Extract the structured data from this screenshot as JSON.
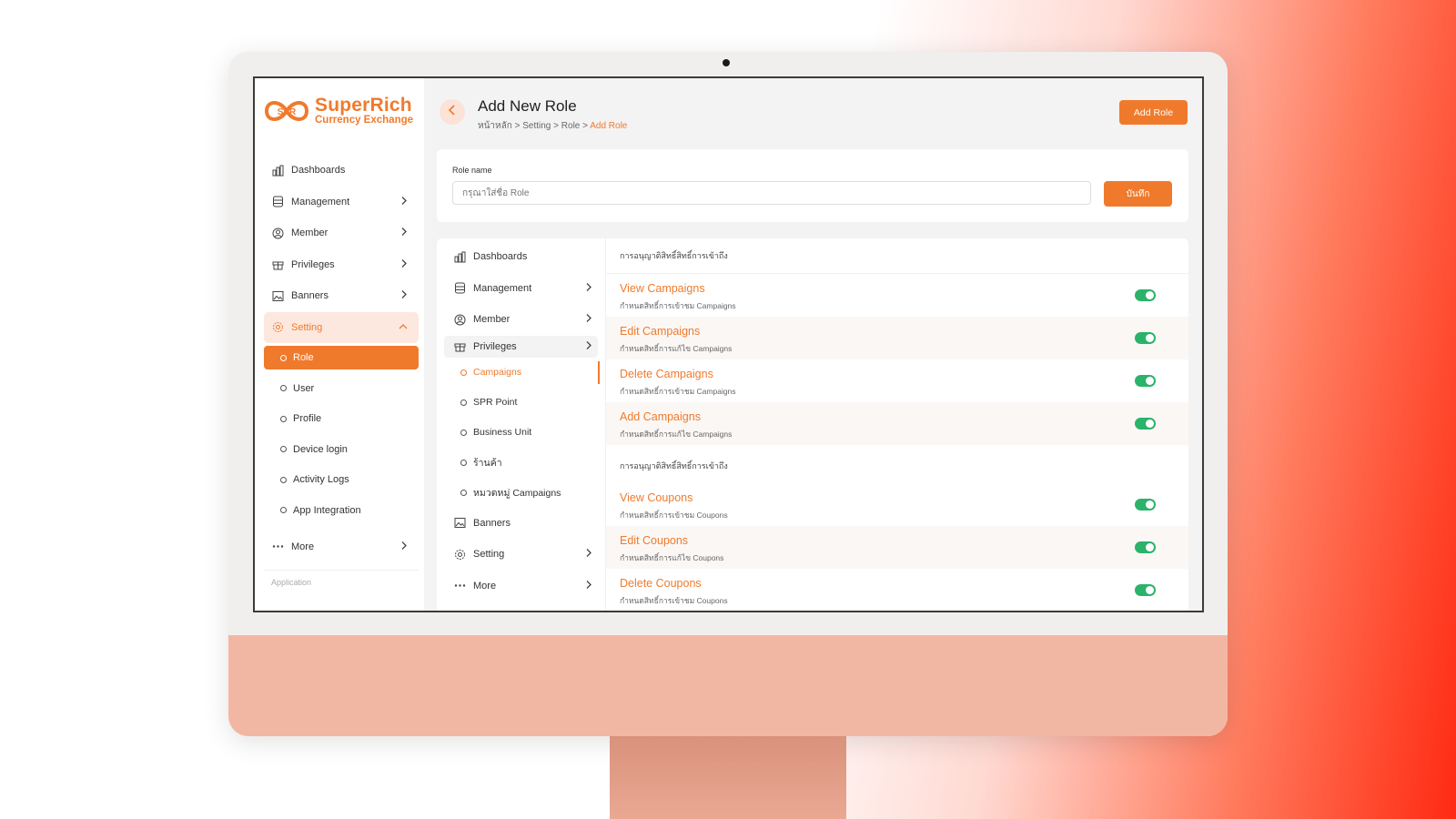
{
  "brand": {
    "mark": "SPR",
    "title": "SuperRich",
    "subtitle": "Currency Exchange",
    "color": "#f07a2c"
  },
  "sidebar": {
    "items": [
      {
        "label": "Dashboards",
        "icon": "bar-chart-icon"
      },
      {
        "label": "Management",
        "icon": "database-icon"
      },
      {
        "label": "Member",
        "icon": "user-circle-icon"
      },
      {
        "label": "Privileges",
        "icon": "gift-icon"
      },
      {
        "label": "Banners",
        "icon": "image-icon"
      },
      {
        "label": "Setting",
        "icon": "gear-icon"
      }
    ],
    "setting_sub": [
      "Role",
      "User",
      "Profile",
      "Device login",
      "Activity Logs",
      "App Integration"
    ],
    "more": "More",
    "app_label": "Application"
  },
  "header": {
    "title": "Add New Role",
    "breadcrumb": [
      "หน้าหลัก",
      "Setting",
      "Role"
    ],
    "breadcrumb_current": "Add Role",
    "add_role_label": "Add Role"
  },
  "role_form": {
    "label": "Role name",
    "placeholder": "กรุณาใส่ชื่อ Role",
    "save_label": "บันทึก"
  },
  "perm_menu": {
    "items": [
      {
        "label": "Dashboards"
      },
      {
        "label": "Management"
      },
      {
        "label": "Member"
      },
      {
        "label": "Privileges"
      }
    ],
    "privileges_sub": [
      "Campaigns",
      "SPR Point",
      "Business Unit",
      "ร้านค้า",
      "หมวดหมู่ Campaigns"
    ],
    "after": [
      {
        "label": "Banners"
      },
      {
        "label": "Setting"
      },
      {
        "label": "More"
      }
    ]
  },
  "permissions": {
    "section1": "การอนุญาติสิทธิ์สิทธิ์การเข้าถึง",
    "campaigns": [
      {
        "title": "View Campaigns",
        "desc": "กำหนดสิทธิ์การเข้าชม Campaigns",
        "enabled": true
      },
      {
        "title": "Edit Campaigns",
        "desc": "กำหนดสิทธิ์การแก้ไข Campaigns",
        "enabled": true
      },
      {
        "title": "Delete Campaigns",
        "desc": "กำหนดสิทธิ์การเข้าชม Campaigns",
        "enabled": true
      },
      {
        "title": "Add Campaigns",
        "desc": "กำหนดสิทธิ์การแก้ไข Campaigns",
        "enabled": true
      }
    ],
    "section2": "การอนุญาติสิทธิ์สิทธิ์การเข้าถึง",
    "coupons": [
      {
        "title": "View Coupons",
        "desc": "กำหนดสิทธิ์การเข้าชม Coupons",
        "enabled": true
      },
      {
        "title": "Edit Coupons",
        "desc": "กำหนดสิทธิ์การแก้ไข Coupons",
        "enabled": true
      },
      {
        "title": "Delete Coupons",
        "desc": "กำหนดสิทธิ์การเข้าชม Coupons",
        "enabled": true
      }
    ],
    "toggle_on_color": "#2bb36b"
  }
}
